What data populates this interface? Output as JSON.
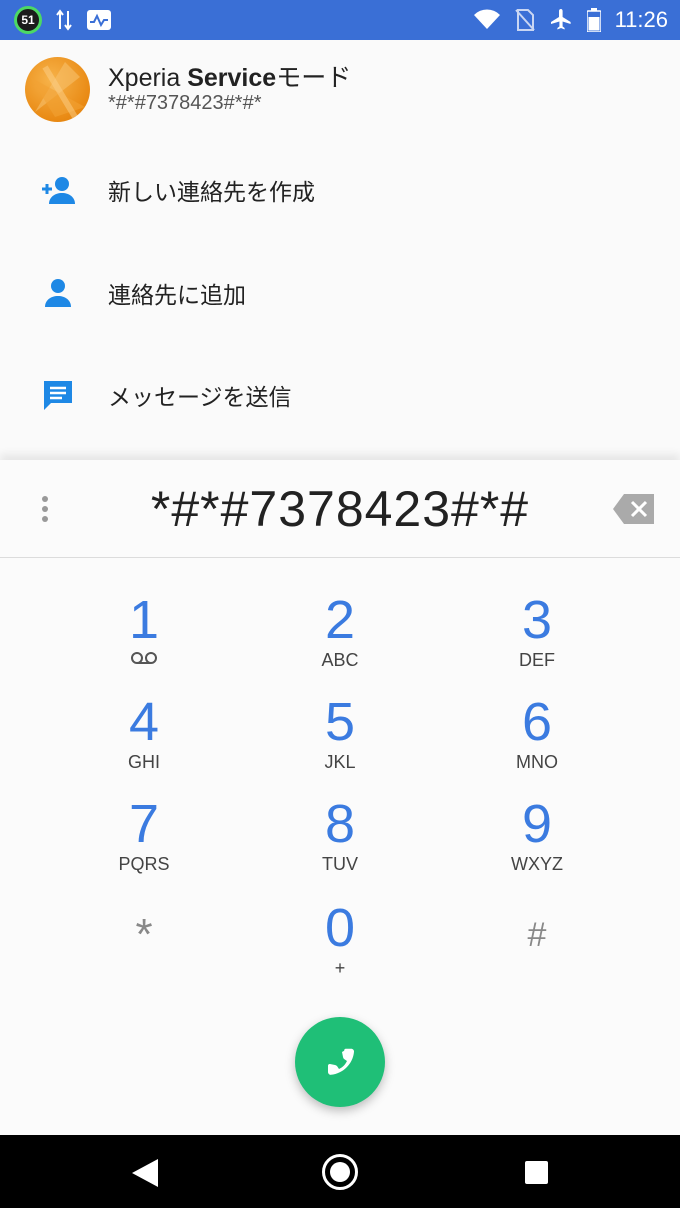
{
  "status_bar": {
    "badge": "51",
    "time": "11:26",
    "icons": [
      "sim-signal-icon",
      "activity-icon",
      "wifi-icon",
      "no-sim-icon",
      "airplane-icon",
      "battery-icon"
    ]
  },
  "contact": {
    "name_prefix": "Xperia ",
    "name_bold": "Service",
    "name_suffix": "モード",
    "number": "*#*#7378423#*#*"
  },
  "actions": [
    {
      "label": "新しい連絡先を作成",
      "icon": "add-person-icon"
    },
    {
      "label": "連絡先に追加",
      "icon": "person-icon"
    },
    {
      "label": "メッセージを送信",
      "icon": "message-icon"
    }
  ],
  "dialer": {
    "digits": "*#*#7378423#*#",
    "keys": [
      {
        "num": "1",
        "sub": ""
      },
      {
        "num": "2",
        "sub": "ABC"
      },
      {
        "num": "3",
        "sub": "DEF"
      },
      {
        "num": "4",
        "sub": "GHI"
      },
      {
        "num": "5",
        "sub": "JKL"
      },
      {
        "num": "6",
        "sub": "MNO"
      },
      {
        "num": "7",
        "sub": "PQRS"
      },
      {
        "num": "8",
        "sub": "TUV"
      },
      {
        "num": "9",
        "sub": "WXYZ"
      },
      {
        "num": "*",
        "sub": ""
      },
      {
        "num": "0",
        "sub": "+"
      },
      {
        "num": "#",
        "sub": ""
      }
    ]
  },
  "colors": {
    "status_bar": "#3a6fd6",
    "accent_blue": "#3b7be0",
    "action_icon": "#1e88e5",
    "call_green": "#1fbf77"
  }
}
